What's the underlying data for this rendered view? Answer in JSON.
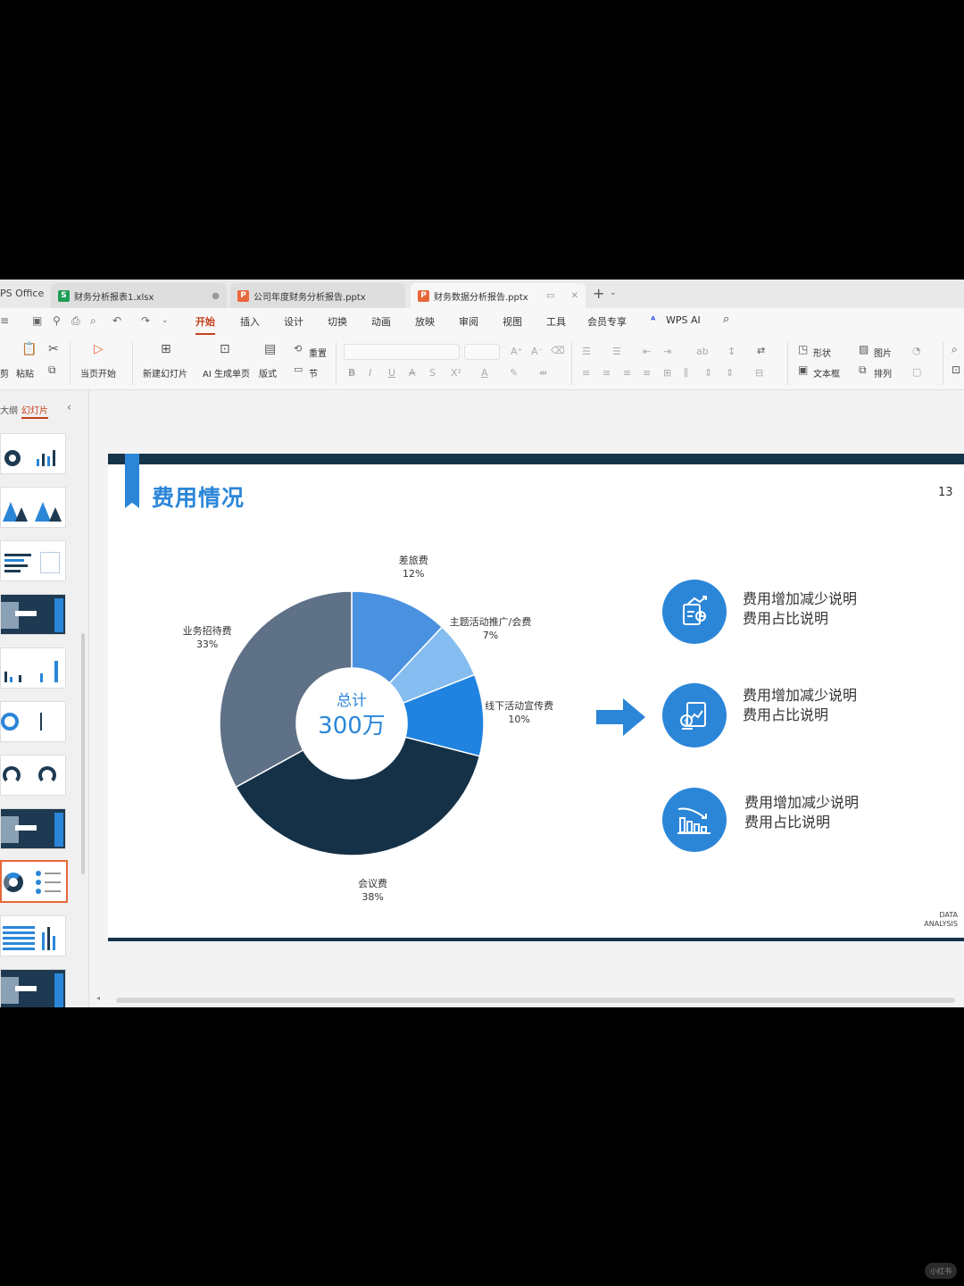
{
  "tabs": {
    "app_name": "PS Office",
    "items": [
      {
        "label": "财务分析报表1.xlsx",
        "icon": "S",
        "icon_color": "#1f9d55"
      },
      {
        "label": "公司年度财务分析报告.pptx",
        "icon": "P",
        "icon_color": "#e8683c"
      },
      {
        "label": "财务数据分析报告.pptx",
        "icon": "P",
        "icon_color": "#e8683c"
      }
    ],
    "close_glyph": "✕"
  },
  "menu": {
    "items": [
      "开始",
      "插入",
      "设计",
      "切换",
      "动画",
      "放映",
      "审阅",
      "视图",
      "工具",
      "会员专享"
    ],
    "active": "开始",
    "wps_ai": "WPS AI"
  },
  "ribbon": {
    "paste": "粘贴",
    "cut_label": "剪",
    "start_from_current": "当页开始",
    "new_slide": "新建幻灯片",
    "ai_page": "AI 生成单页",
    "layout": "版式",
    "reset": "重置",
    "section": "节",
    "shape": "形状",
    "picture": "图片",
    "textbox": "文本框",
    "arrange": "排列"
  },
  "sidepanel": {
    "outline_tab": "大纲",
    "slides_tab": "幻灯片"
  },
  "slide": {
    "title": "费用情况",
    "number": "13",
    "footer_line1": "DATA",
    "footer_line2": "ANALYSIS",
    "total_label": "总计",
    "total_value": "300万",
    "info_items": [
      {
        "line1": "费用增加减少说明",
        "line2": "费用占比说明",
        "icon": "document-chart-icon"
      },
      {
        "line1": "费用增加减少说明",
        "line2": "费用占比说明",
        "icon": "money-chart-icon"
      },
      {
        "line1": "费用增加减少说明",
        "line2": "费用占比说明",
        "icon": "bar-decline-icon"
      }
    ]
  },
  "chart_data": {
    "type": "pie",
    "variant": "donut",
    "slices": [
      {
        "name": "差旅费",
        "label": "12%",
        "value": 12,
        "color": "#4a92e0"
      },
      {
        "name": "主题活动推广/会费",
        "label": "7%",
        "value": 7,
        "color": "#86bdf0"
      },
      {
        "name": "线下活动宣传费",
        "label": "10%",
        "value": 10,
        "color": "#2083e0"
      },
      {
        "name": "会议费",
        "label": "38%",
        "value": 38,
        "color": "#143147"
      },
      {
        "name": "业务招待费",
        "label": "33%",
        "value": 33,
        "color": "#5f7186"
      }
    ],
    "start_angle": "12 o'clock",
    "direction": "clockwise"
  }
}
